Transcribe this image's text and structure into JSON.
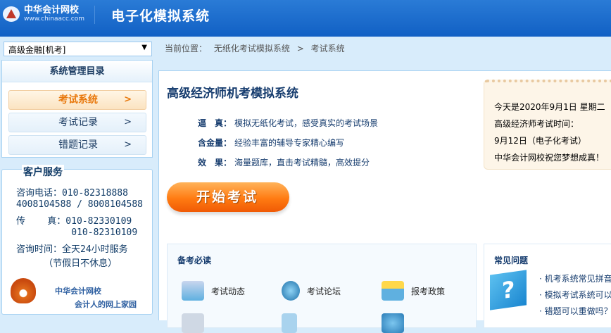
{
  "header": {
    "logo_name": "中华会计网校",
    "logo_url_text": "www.chinaacc.com",
    "title": "电子化模拟系统"
  },
  "sidebar": {
    "select_value": "高级金融[机考]",
    "menu_title": "系统管理目录",
    "items": [
      {
        "label": "考试系统",
        "active": true
      },
      {
        "label": "考试记录"
      },
      {
        "label": "错题记录"
      }
    ],
    "service": {
      "title": "客户服务",
      "lines": [
        "咨询电话：010-82318888",
        "4008104588 / 8008104588",
        "传    真：010-82330109",
        "          010-82310109",
        "咨询时间：全天24小时服务",
        "     （节假日不休息）"
      ],
      "slogan1": "中华会计网校",
      "slogan2": "会计人的网上家园"
    }
  },
  "breadcrumb": {
    "label": "当前位置：",
    "path1": "无纸化考试模拟系统",
    "sep": ">",
    "path2": "考试系统"
  },
  "main": {
    "title": "高级经济师机考模拟系统",
    "features": [
      {
        "k": "逼　真：",
        "v": "模拟无纸化考试，感受真实的考试场景"
      },
      {
        "k": "含金量：",
        "v": "经验丰富的辅导专家精心编写"
      },
      {
        "k": "效　果：",
        "v": "海量题库，直击考试精髓，高效提分"
      }
    ],
    "start_button": "开始考试",
    "notice": [
      "今天是2020年9月1日 星期二",
      "高级经济师考试时间：",
      "9月12日（电子化考试）",
      "中华会计网校祝您梦想成真！"
    ],
    "prep": {
      "title": "备考必读",
      "items": [
        "考试动态",
        "考试论坛",
        "报考政策"
      ]
    },
    "faq": {
      "title": "常见问题",
      "items": [
        "· 机考系统常见拼音",
        "· 模拟考试系统可以",
        "· 错题可以重做吗？"
      ]
    }
  },
  "colors": {
    "header": "#1a6ccc",
    "accent": "#ff7b12",
    "text": "#163c6e"
  }
}
